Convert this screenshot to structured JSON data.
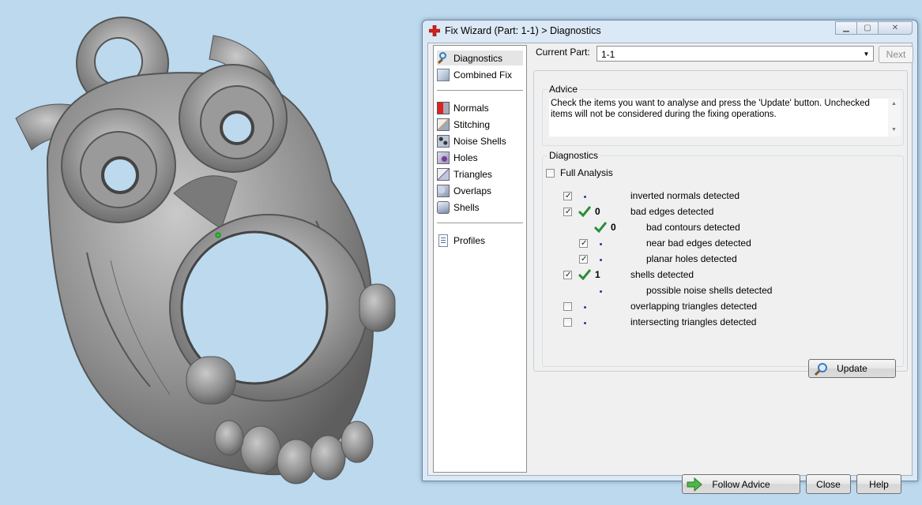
{
  "window": {
    "title": "Fix Wizard (Part: 1-1) > Diagnostics",
    "controls": [
      "minimize-icon",
      "maximize-icon",
      "close-icon"
    ]
  },
  "nav": {
    "group1": [
      {
        "label": "Diagnostics",
        "icon": "magnifier-icon",
        "selected": true
      },
      {
        "label": "Combined Fix",
        "icon": "cube-icon"
      }
    ],
    "group2": [
      {
        "label": "Normals",
        "icon": "normals-icon"
      },
      {
        "label": "Stitching",
        "icon": "stitching-icon"
      },
      {
        "label": "Noise Shells",
        "icon": "noise-shells-icon"
      },
      {
        "label": "Holes",
        "icon": "holes-icon"
      },
      {
        "label": "Triangles",
        "icon": "triangles-icon"
      },
      {
        "label": "Overlaps",
        "icon": "overlaps-icon"
      },
      {
        "label": "Shells",
        "icon": "shells-icon"
      }
    ],
    "group3": [
      {
        "label": "Profiles",
        "icon": "profiles-icon"
      }
    ]
  },
  "current_part": {
    "label": "Current Part:",
    "value": "1-1",
    "next_label": "Next"
  },
  "advice": {
    "legend": "Advice",
    "text": "Check the items you want to analyse and press the 'Update' button. Unchecked items will not be considered during the fixing operations."
  },
  "diagnostics": {
    "legend": "Diagnostics",
    "full_analysis": {
      "label": "Full Analysis",
      "checked": false
    },
    "rows": [
      {
        "label": "inverted normals detected",
        "checked": true,
        "indent": 0,
        "result": "dot",
        "count": ""
      },
      {
        "label": "bad edges detected",
        "checked": true,
        "indent": 0,
        "result": "tick",
        "count": "0"
      },
      {
        "label": "bad contours detected",
        "checked": null,
        "indent": 1,
        "result": "tick",
        "count": "0"
      },
      {
        "label": "near bad edges detected",
        "checked": true,
        "indent": 1,
        "result": "dot",
        "count": ""
      },
      {
        "label": "planar holes detected",
        "checked": true,
        "indent": 1,
        "result": "dot",
        "count": ""
      },
      {
        "label": "shells detected",
        "checked": true,
        "indent": 0,
        "result": "tick",
        "count": "1"
      },
      {
        "label": "possible noise shells detected",
        "checked": null,
        "indent": 1,
        "result": "dot",
        "count": ""
      },
      {
        "label": "overlapping triangles detected",
        "checked": false,
        "indent": 0,
        "result": "dot",
        "count": ""
      },
      {
        "label": "intersecting triangles detected",
        "checked": false,
        "indent": 0,
        "result": "dot",
        "count": ""
      }
    ],
    "update_label": "Update"
  },
  "footer": {
    "follow_advice_label": "Follow Advice",
    "close_label": "Close",
    "help_label": "Help"
  },
  "colors": {
    "desktop_bg": "#bcd9ee",
    "model_gray": "#8c8c8c",
    "ok_green": "#2e8b3a",
    "dot_blue": "#1f3aa8"
  }
}
